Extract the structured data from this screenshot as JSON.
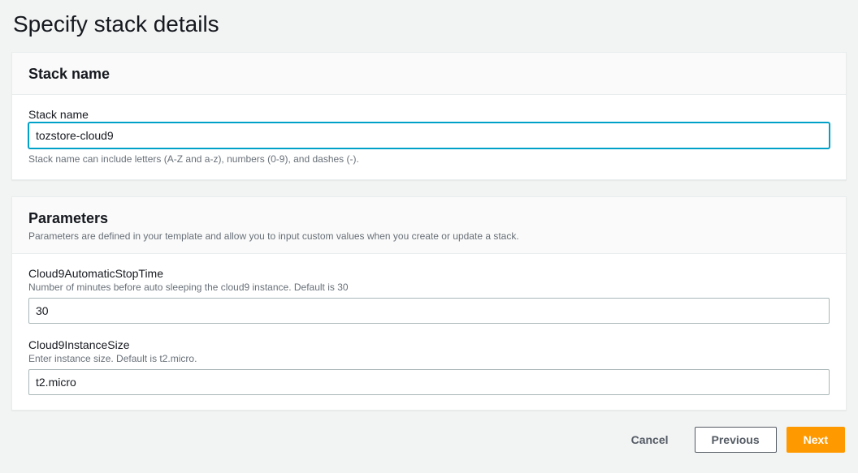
{
  "page": {
    "title": "Specify stack details"
  },
  "stackName": {
    "heading": "Stack name",
    "label": "Stack name",
    "value": "tozstore-cloud9",
    "help": "Stack name can include letters (A-Z and a-z), numbers (0-9), and dashes (-)."
  },
  "parameters": {
    "heading": "Parameters",
    "desc": "Parameters are defined in your template and allow you to input custom values when you create or update a stack.",
    "fields": [
      {
        "label": "Cloud9AutomaticStopTime",
        "desc": "Number of minutes before auto sleeping the cloud9 instance. Default is 30",
        "value": "30"
      },
      {
        "label": "Cloud9InstanceSize",
        "desc": "Enter instance size. Default is t2.micro.",
        "value": "t2.micro"
      }
    ]
  },
  "footer": {
    "cancel": "Cancel",
    "previous": "Previous",
    "next": "Next"
  }
}
